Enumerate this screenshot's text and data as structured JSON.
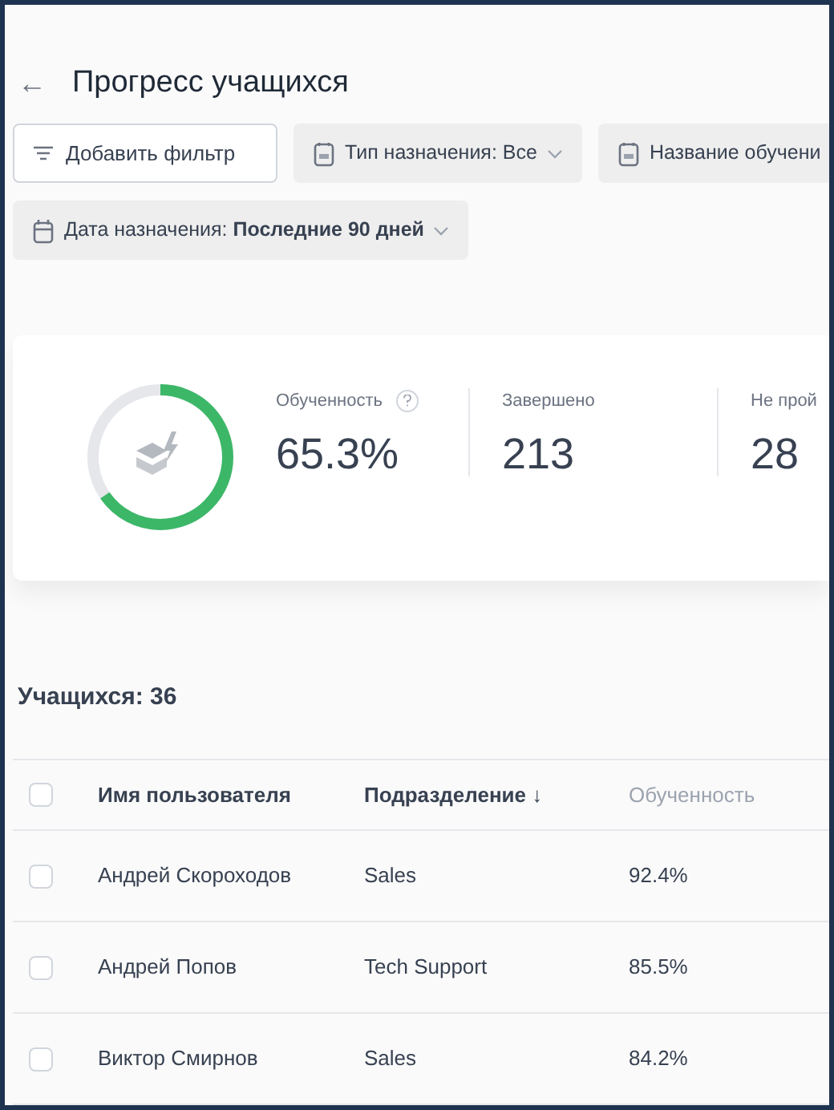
{
  "page": {
    "back": "←",
    "title": "Прогресс учащихся"
  },
  "filters": [
    {
      "kind": "add",
      "label": "Добавить фильтр"
    },
    {
      "kind": "document",
      "label": "Тип назначения: Все",
      "dropdown": true
    },
    {
      "kind": "document",
      "label": "Название обучени",
      "dropdown": false
    },
    {
      "kind": "date",
      "label": "Дата назначения: ",
      "bold": "Последние 90 дней",
      "dropdown": true
    }
  ],
  "summary": {
    "stats": [
      {
        "label": "Обученность",
        "value": "65.3%",
        "help": true
      },
      {
        "label": "Завершено",
        "value": "213",
        "help": false
      },
      {
        "label": "Не прой",
        "value": "28",
        "help": false
      }
    ]
  },
  "table": {
    "count": "Учащихся: 36",
    "all_checked": false,
    "columns": [
      {
        "label": "Имя пользователя",
        "muted": false
      },
      {
        "label": "Подразделение",
        "sort": "↓",
        "muted": false
      },
      {
        "label": "Обученность",
        "muted": true
      }
    ],
    "rows": [
      {
        "checked": false,
        "cells": [
          "Андрей Скороходов",
          "Sales",
          "92.4%"
        ]
      },
      {
        "checked": false,
        "cells": [
          "Андрей Попов",
          "Tech Support",
          "85.5%"
        ]
      },
      {
        "checked": false,
        "cells": [
          "Виктор Смирнов",
          "Sales",
          "84.2%"
        ]
      }
    ]
  }
}
